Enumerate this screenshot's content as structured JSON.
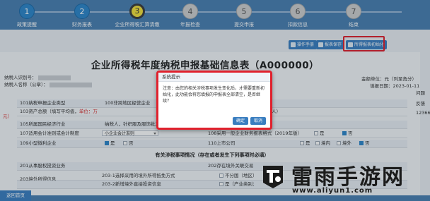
{
  "steps": [
    {
      "num": "1",
      "label": "政策提醒",
      "state": "done"
    },
    {
      "num": "2",
      "label": "财务报表",
      "state": "done"
    },
    {
      "num": "3",
      "label": "企业所得税汇算清缴",
      "state": "current"
    },
    {
      "num": "4",
      "label": "年报检查",
      "state": "todo"
    },
    {
      "num": "5",
      "label": "提交申报",
      "state": "todo"
    },
    {
      "num": "6",
      "label": "扣款信息",
      "state": "todo"
    },
    {
      "num": "7",
      "label": "结束",
      "state": "todo"
    }
  ],
  "toolbar": {
    "btn1": "操作手册",
    "btn2": "报表保存",
    "btn3": "所得报表初始化"
  },
  "form": {
    "title": "企业所得税年度纳税申报基础信息表（A000000）",
    "taxpayer_id_label": "纳税人识别号：",
    "taxpayer_name_label": "纳税人名称（公章）：",
    "amount_unit": "金额单位：元（列至角分）",
    "fill_date": "填报日期：2023-01-11",
    "right_edge_1": "问题",
    "right_edge_2": "反馈",
    "right_edge_3": "12366"
  },
  "rows": {
    "r101_label": "101纳税申报企业类型",
    "r101_value": "100非跨地区经营企业",
    "r103_label": "103资产总额（填写平均值，",
    "r103_unit": "单位：万",
    "r103_tail": "元）",
    "r_people": "人）",
    "r105_label": "105所属国民经济行业",
    "r105_value": "纳税人，针织服及服饰批发",
    "r107_label": "107适用会计准则或会计制度",
    "r107_value": "小企业会计准则",
    "r108_label": "108采用一般企业财务报表格式（2019年版）",
    "r109_label": "109小型微利企业",
    "r110_label": "110上市公司",
    "yes": "是",
    "no": "否",
    "domestic": "境内",
    "overseas": "境外",
    "section": "有关涉税事项情况（存在或者发生下列事项时必填）",
    "r201_label": "201从事股权投资业务",
    "r202_label": "202存在境外关联交易",
    "r203_label": "203境外所得信息",
    "r2031_label": "203-1选择采用的境外所得抵免方式",
    "r2031_value": "不分国（地区）",
    "r2032_label": "203-2新增境外直接投资信息",
    "r2032_value": "是（产业类别："
  },
  "dialog": {
    "title": "系统提示",
    "message": "注意：由您的相关涉税事项发生变化后，才需要重新初始化，此功能会将您填报的申报表全部清空，是否继续？",
    "ok": "确定",
    "cancel": "取消"
  },
  "bottom": {
    "back": "返回首页"
  },
  "watermark": {
    "text": "雷雨手游网",
    "url": "www.aliyun1.com"
  },
  "colors": {
    "stepbar": "#4a7fb1",
    "accent": "#3a7ec0",
    "highlight": "#e0212d",
    "current_step": "#f4e03c"
  }
}
